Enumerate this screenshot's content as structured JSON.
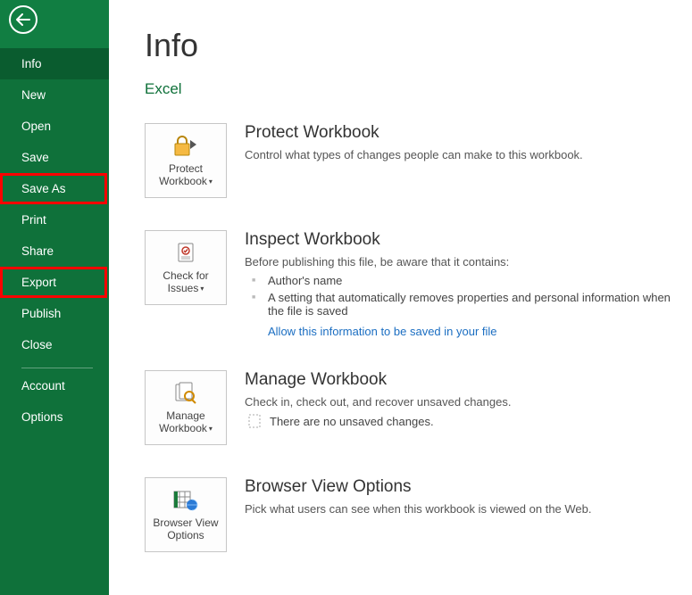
{
  "sidebar": {
    "items": [
      {
        "label": "Info",
        "selected": true,
        "highlighted": false
      },
      {
        "label": "New",
        "selected": false,
        "highlighted": false
      },
      {
        "label": "Open",
        "selected": false,
        "highlighted": false
      },
      {
        "label": "Save",
        "selected": false,
        "highlighted": false
      },
      {
        "label": "Save As",
        "selected": false,
        "highlighted": true
      },
      {
        "label": "Print",
        "selected": false,
        "highlighted": false
      },
      {
        "label": "Share",
        "selected": false,
        "highlighted": false
      },
      {
        "label": "Export",
        "selected": false,
        "highlighted": true
      },
      {
        "label": "Publish",
        "selected": false,
        "highlighted": false
      },
      {
        "label": "Close",
        "selected": false,
        "highlighted": false
      }
    ],
    "footer": [
      {
        "label": "Account"
      },
      {
        "label": "Options"
      }
    ]
  },
  "page": {
    "title": "Info",
    "subtitle": "Excel"
  },
  "protect": {
    "tile_label_l1": "Protect",
    "tile_label_l2": "Workbook",
    "title": "Protect Workbook",
    "desc": "Control what types of changes people can make to this workbook."
  },
  "inspect": {
    "tile_label_l1": "Check for",
    "tile_label_l2": "Issues",
    "title": "Inspect Workbook",
    "desc": "Before publishing this file, be aware that it contains:",
    "bullets": [
      "Author's name",
      "A setting that automatically removes properties and personal information when the file is saved"
    ],
    "link": "Allow this information to be saved in your file"
  },
  "manage": {
    "tile_label_l1": "Manage",
    "tile_label_l2": "Workbook",
    "title": "Manage Workbook",
    "desc": "Check in, check out, and recover unsaved changes.",
    "status": "There are no unsaved changes."
  },
  "browser": {
    "tile_label_l1": "Browser View",
    "tile_label_l2": "Options",
    "title": "Browser View Options",
    "desc": "Pick what users can see when this workbook is viewed on the Web."
  }
}
